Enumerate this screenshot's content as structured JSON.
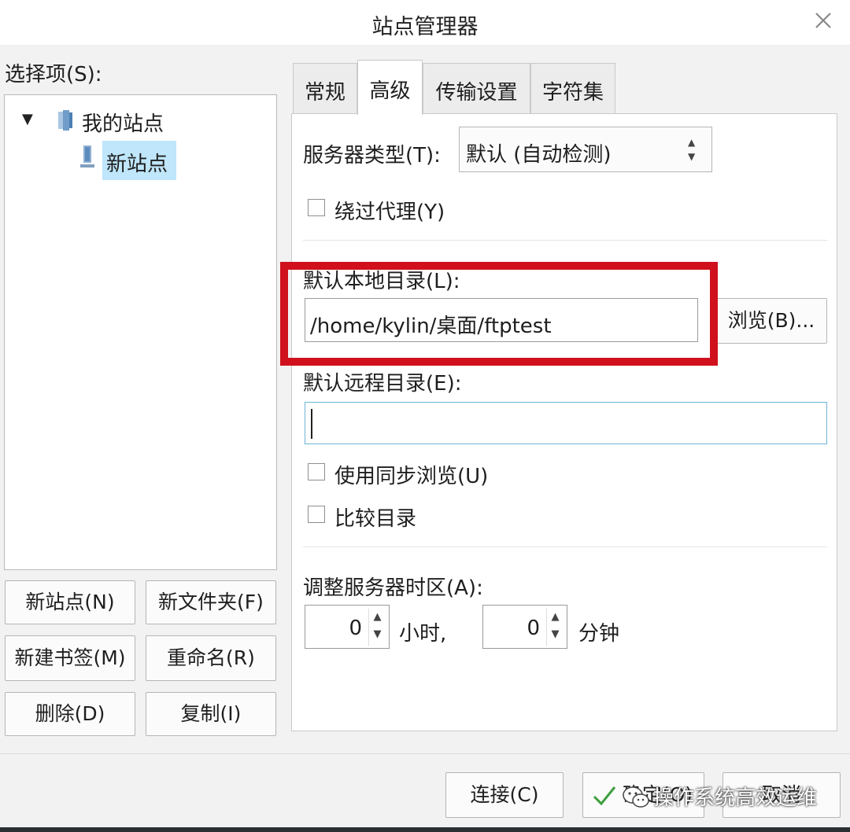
{
  "window": {
    "title": "站点管理器"
  },
  "left": {
    "select_label": "选择项(S):",
    "tree": {
      "root_label": "我的站点",
      "site_label": "新站点"
    },
    "buttons": {
      "new_site": "新站点(N)",
      "new_folder": "新文件夹(F)",
      "new_bookmark": "新建书签(M)",
      "rename": "重命名(R)",
      "delete": "删除(D)",
      "copy": "复制(I)"
    }
  },
  "tabs": {
    "general": "常规",
    "advanced": "高级",
    "transfer": "传输设置",
    "charset": "字符集"
  },
  "advanced": {
    "server_type_label": "服务器类型(T):",
    "server_type_value": "默认 (自动检测)",
    "bypass_proxy_label": "绕过代理(Y)",
    "bypass_proxy_checked": false,
    "local_dir_label": "默认本地目录(L):",
    "local_dir_value": "/home/kylin/桌面/ftptest",
    "browse_label": "浏览(B)...",
    "remote_dir_label": "默认远程目录(E):",
    "remote_dir_value": "",
    "sync_browse_label": "使用同步浏览(U)",
    "sync_browse_checked": false,
    "compare_dir_label": "比较目录",
    "compare_dir_checked": false,
    "timezone_label": "调整服务器时区(A):",
    "hours_value": "0",
    "hours_unit": "小时,",
    "minutes_value": "0",
    "minutes_unit": "分钟"
  },
  "footer": {
    "connect_label": "连接(C)",
    "ok_label": "确定(O)",
    "cancel_label": "取消"
  },
  "watermark": {
    "text": "操作系统高效运维"
  },
  "colors": {
    "highlight": "#d0101c",
    "selection": "#bfe6fb",
    "focus_border": "#6cb4d8"
  }
}
